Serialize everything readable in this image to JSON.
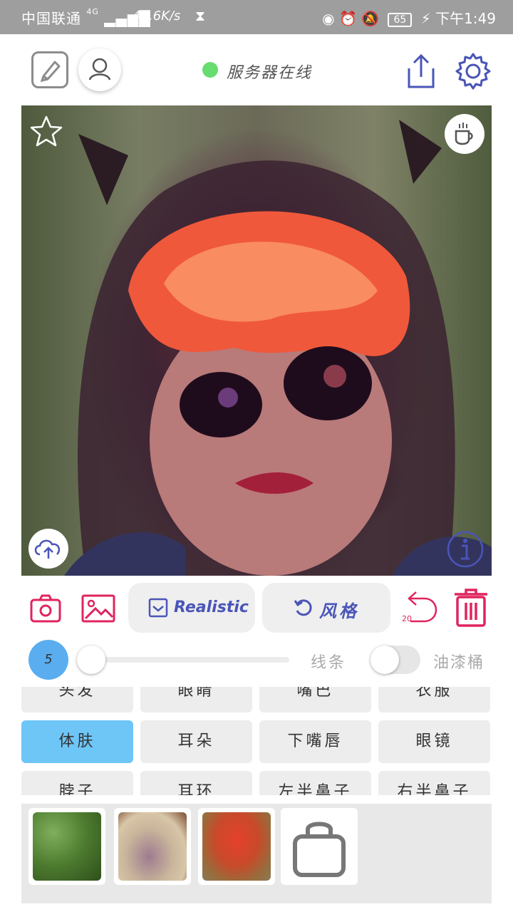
{
  "status_bar": {
    "carrier": "中国联通",
    "network": "4G",
    "speed": "47.6K/s",
    "battery": "65",
    "time": "下午1:49"
  },
  "top_bar": {
    "server_status": "服务器在线",
    "server_status_color": "#66dd6e"
  },
  "canvas": {
    "icons": [
      "star-icon",
      "coffee-cup-icon",
      "upload-cloud-icon",
      "info-icon"
    ]
  },
  "tools": {
    "mode_label": "Realistic",
    "style_label": "风格",
    "undo_count": "20",
    "accent_red": "#e0245e",
    "accent_blue": "#4a55b8"
  },
  "brush": {
    "size": "5",
    "line_label": "线条",
    "bucket_label": "油漆桶"
  },
  "parts": [
    "头发",
    "眼睛",
    "嘴巴",
    "衣服",
    "体肤",
    "耳朵",
    "下嘴唇",
    "眼镜",
    "脖子",
    "耳环",
    "左半鼻子",
    "右半鼻子"
  ],
  "selected_part": "体肤",
  "thumbnails": {
    "count": 3,
    "store_icon": "shopping-bag-icon"
  }
}
